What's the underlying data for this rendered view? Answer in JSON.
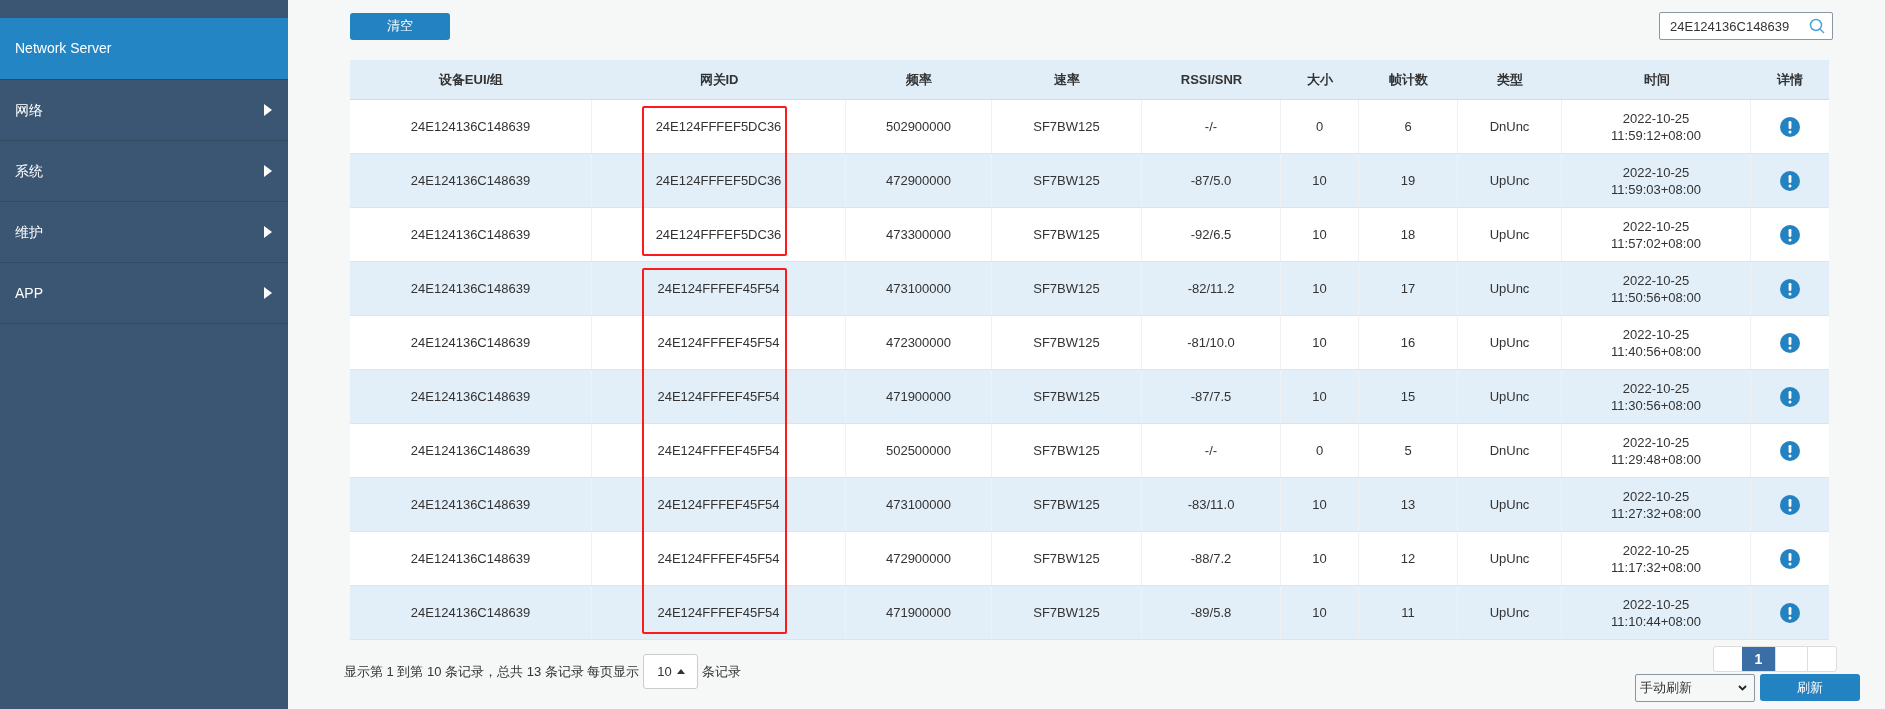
{
  "sidebar": {
    "items": [
      {
        "label": "Network Server",
        "selected": true,
        "has_submenu": false
      },
      {
        "label": "网络",
        "selected": false,
        "has_submenu": true
      },
      {
        "label": "系统",
        "selected": false,
        "has_submenu": true
      },
      {
        "label": "维护",
        "selected": false,
        "has_submenu": true
      },
      {
        "label": "APP",
        "selected": false,
        "has_submenu": true
      }
    ]
  },
  "toolbar": {
    "clear_button": "清空",
    "search": {
      "value": "24E124136C148639"
    }
  },
  "table": {
    "columns": [
      "设备EUI/组",
      "网关ID",
      "频率",
      "速率",
      "RSSI/SNR",
      "大小",
      "帧计数",
      "类型",
      "时间",
      "详情"
    ],
    "groups": [
      {
        "outlined": true,
        "rows": [
          {
            "cells": [
              "24E124136C148639",
              "24E124FFFEF5DC36",
              "502900000",
              "SF7BW125",
              "-/-",
              "0",
              "6",
              "DnUnc"
            ],
            "date": "2022-10-25",
            "time": "11:59:12+08:00"
          },
          {
            "cells": [
              "24E124136C148639",
              "24E124FFFEF5DC36",
              "472900000",
              "SF7BW125",
              "-87/5.0",
              "10",
              "19",
              "UpUnc"
            ],
            "date": "2022-10-25",
            "time": "11:59:03+08:00"
          },
          {
            "cells": [
              "24E124136C148639",
              "24E124FFFEF5DC36",
              "473300000",
              "SF7BW125",
              "-92/6.5",
              "10",
              "18",
              "UpUnc"
            ],
            "date": "2022-10-25",
            "time": "11:57:02+08:00"
          }
        ]
      },
      {
        "outlined": true,
        "rows": [
          {
            "cells": [
              "24E124136C148639",
              "24E124FFFEF45F54",
              "473100000",
              "SF7BW125",
              "-82/11.2",
              "10",
              "17",
              "UpUnc"
            ],
            "date": "2022-10-25",
            "time": "11:50:56+08:00"
          },
          {
            "cells": [
              "24E124136C148639",
              "24E124FFFEF45F54",
              "472300000",
              "SF7BW125",
              "-81/10.0",
              "10",
              "16",
              "UpUnc"
            ],
            "date": "2022-10-25",
            "time": "11:40:56+08:00"
          },
          {
            "cells": [
              "24E124136C148639",
              "24E124FFFEF45F54",
              "471900000",
              "SF7BW125",
              "-87/7.5",
              "10",
              "15",
              "UpUnc"
            ],
            "date": "2022-10-25",
            "time": "11:30:56+08:00"
          },
          {
            "cells": [
              "24E124136C148639",
              "24E124FFFEF45F54",
              "502500000",
              "SF7BW125",
              "-/-",
              "0",
              "5",
              "DnUnc"
            ],
            "date": "2022-10-25",
            "time": "11:29:48+08:00"
          },
          {
            "cells": [
              "24E124136C148639",
              "24E124FFFEF45F54",
              "473100000",
              "SF7BW125",
              "-83/11.0",
              "10",
              "13",
              "UpUnc"
            ],
            "date": "2022-10-25",
            "time": "11:27:32+08:00"
          },
          {
            "cells": [
              "24E124136C148639",
              "24E124FFFEF45F54",
              "472900000",
              "SF7BW125",
              "-88/7.2",
              "10",
              "12",
              "UpUnc"
            ],
            "date": "2022-10-25",
            "time": "11:17:32+08:00"
          },
          {
            "cells": [
              "24E124136C148639",
              "24E124FFFEF45F54",
              "471900000",
              "SF7BW125",
              "-89/5.8",
              "10",
              "11",
              "UpUnc"
            ],
            "date": "2022-10-25",
            "time": "11:10:44+08:00"
          }
        ]
      }
    ]
  },
  "footer": {
    "summary": "显示第 1 到第 10 条记录，总共 13 条记录 每页显示",
    "page_size": "10",
    "records_suffix": "条记录",
    "pages": [
      {
        "label": "1",
        "selected": true
      }
    ],
    "refresh_mode": "手动刷新",
    "refresh_button": "刷新"
  }
}
